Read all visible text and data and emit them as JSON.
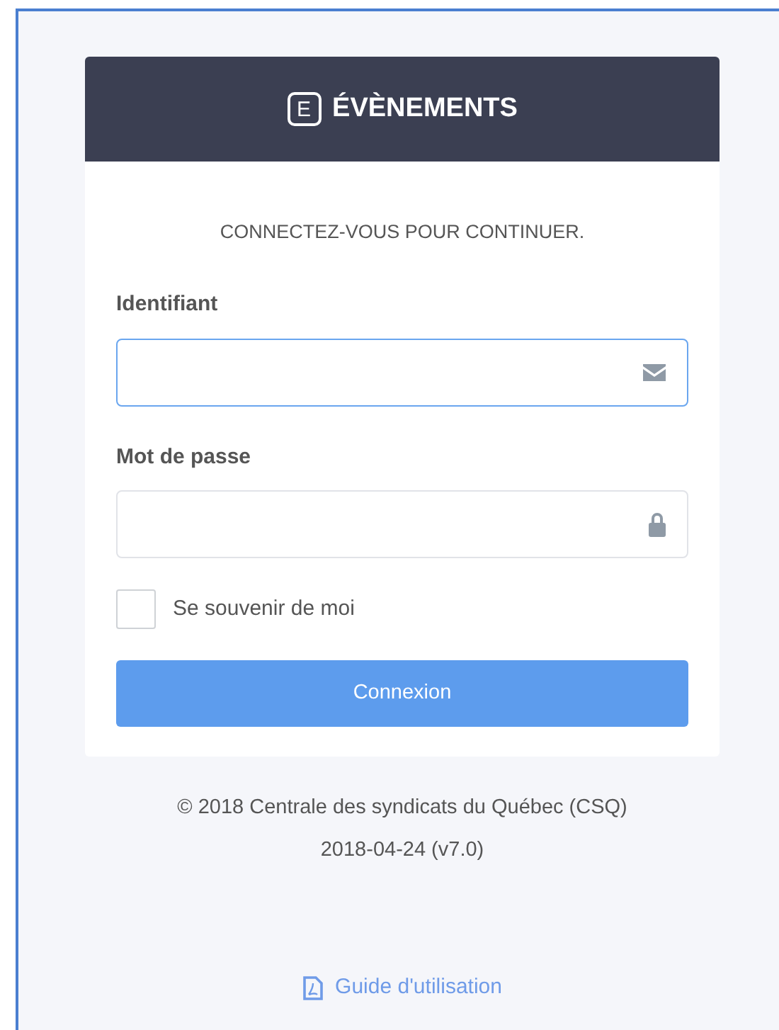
{
  "header": {
    "logo_letter": "E",
    "title": "ÉVÈNEMENTS"
  },
  "subtitle": "CONNECTEZ-VOUS POUR CONTINUER.",
  "fields": [
    {
      "label": "Identifiant",
      "kind": "email",
      "focused": true
    },
    {
      "label": "Mot de passe",
      "kind": "password",
      "focused": false
    }
  ],
  "remember": {
    "label": "Se souvenir de moi",
    "checked": false
  },
  "submit": "Connexion",
  "footer": [
    "© 2018 Centrale des syndicats du Québec (CSQ)",
    "2018-04-24 (v7.0)"
  ],
  "guide_link": "Guide d'utilisation"
}
